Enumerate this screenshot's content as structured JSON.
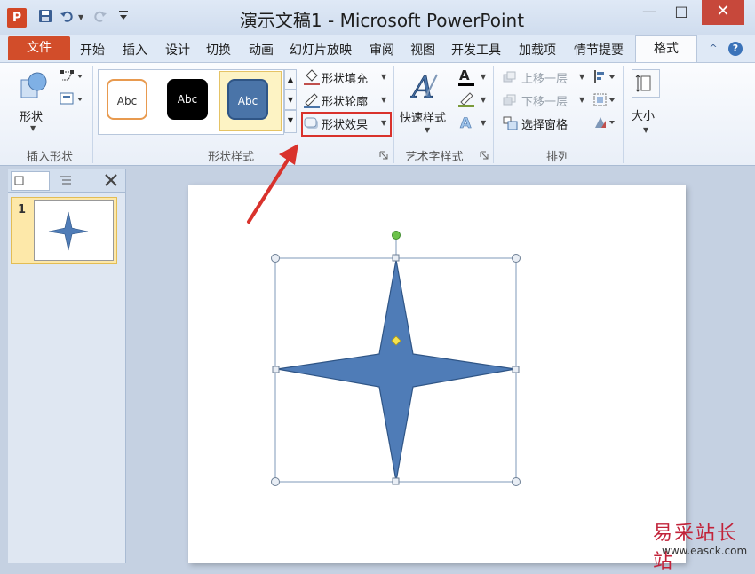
{
  "titlebar": {
    "app_icon": "P",
    "title": "演示文稿1 - Microsoft PowerPoint",
    "qat_icons": [
      "save-icon",
      "undo-icon",
      "redo-icon",
      "customize-icon"
    ],
    "controls": {
      "minimize": "—",
      "maximize": "□",
      "close": "✕"
    }
  },
  "tabs": {
    "file": "文件",
    "items": [
      "开始",
      "插入",
      "设计",
      "切换",
      "动画",
      "幻灯片放映",
      "审阅",
      "视图",
      "开发工具",
      "加载项",
      "情节提要"
    ],
    "format": "格式",
    "collapse_icon": "^",
    "help_icon": "?"
  },
  "ribbon": {
    "insert_shapes": {
      "shapes_label": "形状",
      "group_label": "插入形状"
    },
    "shape_styles": {
      "gallery": [
        "Abc",
        "Abc",
        "Abc"
      ],
      "fill": "形状填充",
      "outline": "形状轮廓",
      "effects": "形状效果",
      "group_label": "形状样式"
    },
    "wordart": {
      "quick_styles": "快速样式",
      "letter": "A",
      "group_label": "艺术字样式"
    },
    "arrange": {
      "bring_forward": "上移一层",
      "send_backward": "下移一层",
      "selection_pane": "选择窗格",
      "group_label": "排列"
    },
    "size": {
      "label": "大小"
    }
  },
  "slides_pane": {
    "slide_number": "1"
  },
  "watermark": {
    "text": "易采站长站",
    "url": "www.easck.com"
  },
  "colors": {
    "shape_fill": "#4f7cb7",
    "shape_outline": "#2f5586",
    "highlight": "#d9322c",
    "accent_file": "#d24d2a"
  }
}
